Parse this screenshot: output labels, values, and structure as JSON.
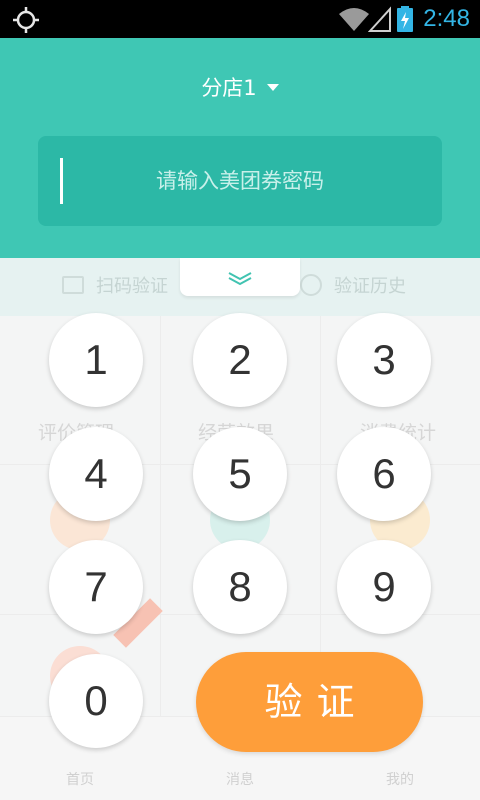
{
  "status_bar": {
    "time": "2:48",
    "icons": [
      "location-crosshair-icon",
      "wifi-icon",
      "no-signal-icon",
      "battery-charging-icon"
    ],
    "time_color": "#33b5e5"
  },
  "header": {
    "store_name": "分店1",
    "input_placeholder": "请输入美团券密码",
    "bg_color": "#3fc7b4",
    "input_bg_color": "#2cb8a6"
  },
  "background_dashboard": {
    "tabs": [
      {
        "label": "扫码验证",
        "icon": "scan-icon"
      },
      {
        "label": "验证历史",
        "icon": "clock-icon"
      }
    ],
    "grid_items": [
      "评价管理",
      "经营效果",
      "消费统计"
    ],
    "bottom_nav": [
      {
        "label": "首页",
        "icon": "home-icon"
      },
      {
        "label": "消息",
        "icon": "message-icon"
      },
      {
        "label": "我的",
        "icon": "user-icon"
      }
    ]
  },
  "keypad": {
    "keys": [
      "1",
      "2",
      "3",
      "4",
      "5",
      "6",
      "7",
      "8",
      "9",
      "0"
    ],
    "verify_label": "验证",
    "verify_color": "#fe9e3a"
  }
}
